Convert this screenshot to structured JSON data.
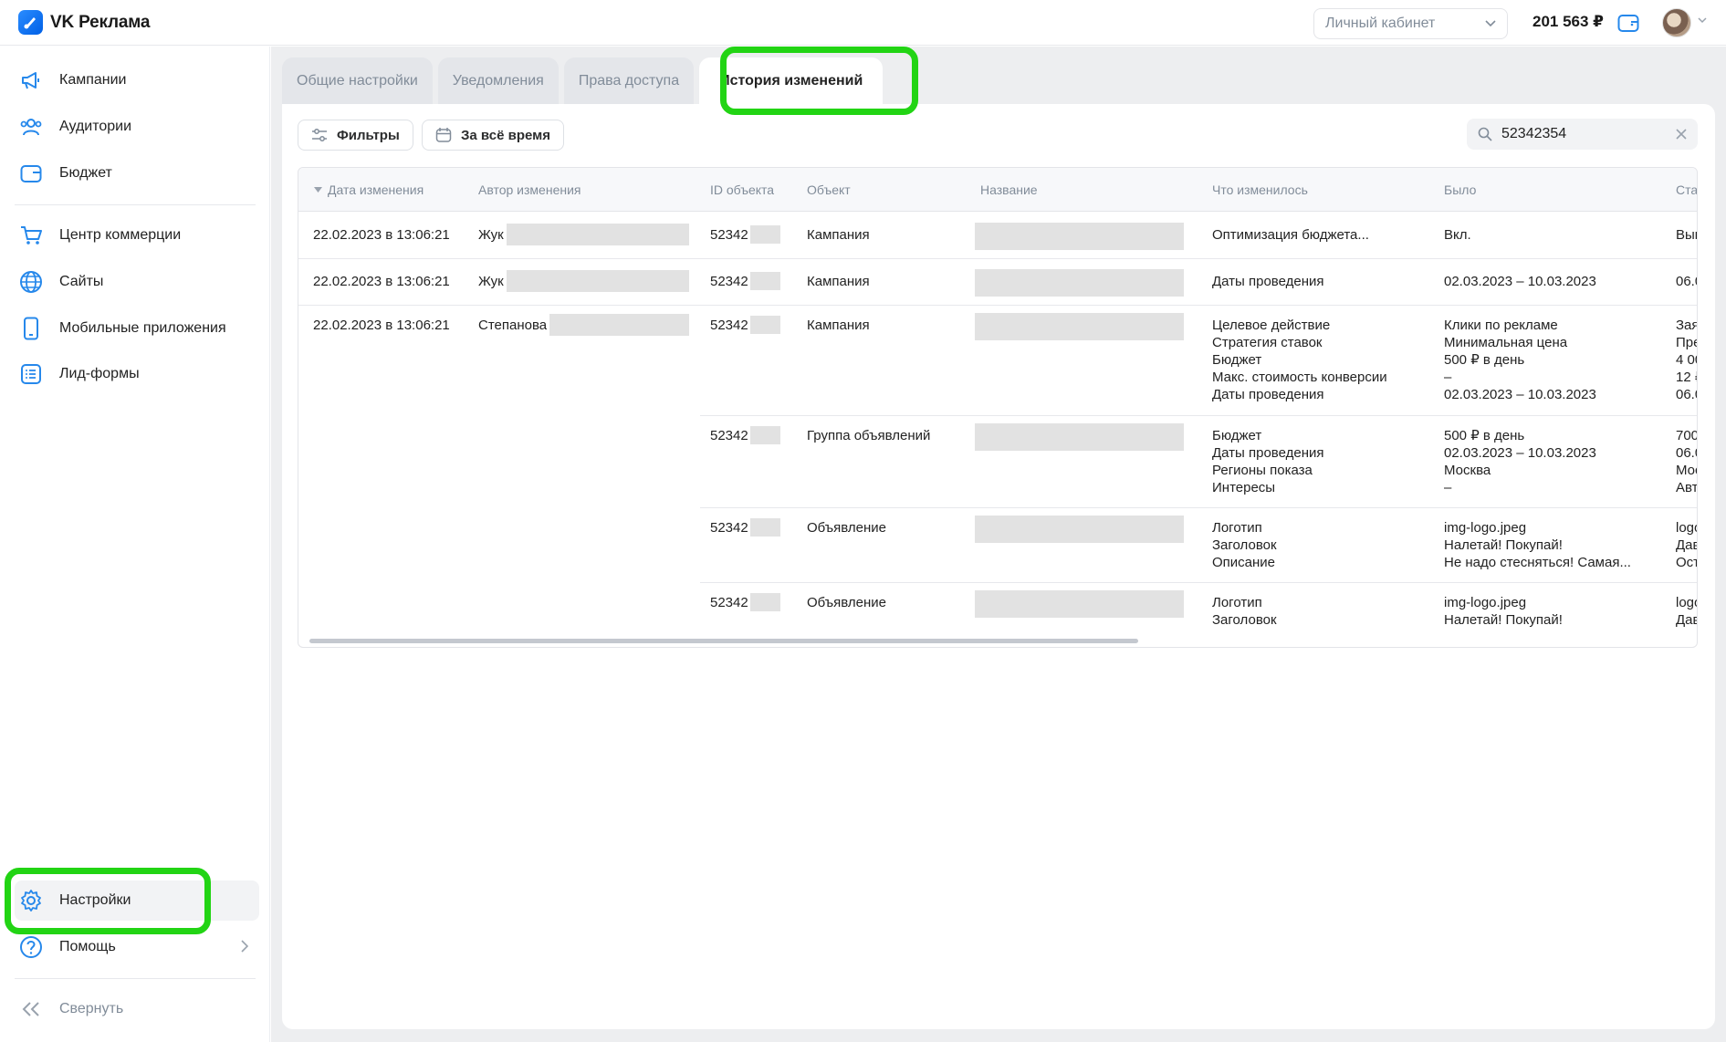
{
  "app": {
    "name": "VK Реклама"
  },
  "header": {
    "account_selector": "Личный кабинет",
    "balance": "201 563 ₽"
  },
  "sidebar": {
    "items": [
      {
        "label": "Кампании",
        "icon": "megaphone-icon"
      },
      {
        "label": "Аудитории",
        "icon": "users-icon"
      },
      {
        "label": "Бюджет",
        "icon": "wallet-icon"
      },
      {
        "label": "Центр коммерции",
        "icon": "cart-icon"
      },
      {
        "label": "Сайты",
        "icon": "globe-icon"
      },
      {
        "label": "Мобильные приложения",
        "icon": "smartphone-icon"
      },
      {
        "label": "Лид-формы",
        "icon": "list-icon"
      }
    ],
    "settings": "Настройки",
    "help": "Помощь",
    "collapse": "Свернуть"
  },
  "tabs": [
    {
      "label": "Общие настройки",
      "active": false
    },
    {
      "label": "Уведомления",
      "active": false
    },
    {
      "label": "Права доступа",
      "active": false
    },
    {
      "label": "История изменений",
      "active": true
    }
  ],
  "toolbar": {
    "filters": "Фильтры",
    "period": "За всё время",
    "search_value": "52342354"
  },
  "table": {
    "columns": [
      "Дата изменения",
      "Автор изменения",
      "ID объекта",
      "Объект",
      "Название",
      "Что изменилось",
      "Было",
      "Ста"
    ],
    "rows": [
      {
        "date": "22.02.2023 в 13:06:21",
        "author": "Жук",
        "id": "52342",
        "object": "Кампания",
        "changes": [
          "Оптимизация бюджета..."
        ],
        "was": [
          "Вкл."
        ],
        "now": [
          "Вык"
        ]
      },
      {
        "date": "22.02.2023 в 13:06:21",
        "author": "Жук",
        "id": "52342",
        "object": "Кампания",
        "changes": [
          "Даты проведения"
        ],
        "was": [
          "02.03.2023 – 10.03.2023"
        ],
        "now": [
          "06.0"
        ]
      },
      {
        "date": "22.02.2023 в 13:06:21",
        "author": "Степанова",
        "id": "52342",
        "object": "Кампания",
        "changes": [
          "Целевое действие",
          "Стратегия ставок",
          "Бюджет",
          "Макс. стоимость конверсии",
          "Даты проведения"
        ],
        "was": [
          "Клики по рекламе",
          "Минимальная цена",
          "500 ₽ в день",
          "–",
          "02.03.2023 – 10.03.2023"
        ],
        "now": [
          "Зая",
          "Пре",
          "4 00",
          "12 ₽",
          "06.0"
        ]
      },
      {
        "id": "52342",
        "object": "Группа объявлений",
        "changes": [
          "Бюджет",
          "Даты проведения",
          "Регионы показа",
          "Интересы"
        ],
        "was": [
          "500 ₽ в день",
          "02.03.2023 – 10.03.2023",
          "Москва",
          "–"
        ],
        "now": [
          "700",
          "06.0",
          "Мос",
          "Авт"
        ]
      },
      {
        "id": "52342",
        "object": "Объявление",
        "changes": [
          "Логотип",
          "Заголовок",
          "Описание"
        ],
        "was": [
          "img-logo.jpeg",
          "Налетай! Покупай!",
          "Не надо стесняться! Самая..."
        ],
        "now": [
          "logo",
          "Дав",
          "Ост"
        ]
      },
      {
        "id": "52342",
        "object": "Объявление",
        "changes": [
          "Логотип",
          "Заголовок"
        ],
        "was": [
          "img-logo.jpeg",
          "Налетай! Покупай!"
        ],
        "now": [
          "logo",
          "Дав"
        ]
      }
    ]
  }
}
